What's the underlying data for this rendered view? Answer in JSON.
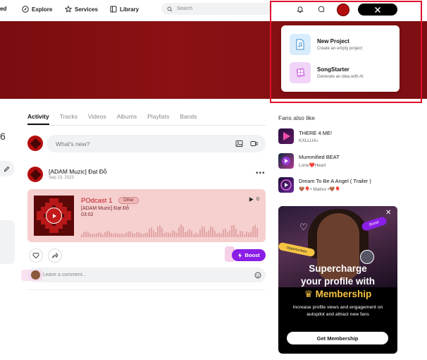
{
  "nav": {
    "edge_text": "ed",
    "explore": "Explore",
    "services": "Services",
    "library": "Library",
    "search_placeholder": "Search"
  },
  "dropdown": {
    "items": [
      {
        "title": "New Project",
        "subtitle": "Create an empty project",
        "icon": "music-file-icon"
      },
      {
        "title": "SongStarter",
        "subtitle": "Generate an idea with AI",
        "icon": "songstarter-icon"
      }
    ]
  },
  "edge": {
    "digit": "6"
  },
  "tabs": [
    "Activity",
    "Tracks",
    "Videos",
    "Albums",
    "Playlists",
    "Bands"
  ],
  "composer": {
    "placeholder": "What's new?"
  },
  "post": {
    "title": "[ADAM Muzic] Đạt Đỗ",
    "date": "Sep 13, 2023",
    "audio": {
      "title": "POdcast 1",
      "tag": "Other",
      "artist": "[ADAM Muzic] Đạt Đỗ",
      "duration": "03:02",
      "plays": "0"
    },
    "boost_label": "Boost",
    "comment_placeholder": "Leave a comment..."
  },
  "fans": {
    "title": "Fans also like",
    "items": [
      {
        "name": "THERE 4 ME!",
        "sub": "KXLLUA♪"
      },
      {
        "name": "Mummified BEAT",
        "sub": "Lone❤️Heart"
      },
      {
        "name": "Dream To Be A Angel ( Trailer )",
        "sub": "🤎🎈• Matixx •🤎🎈"
      }
    ]
  },
  "promo": {
    "badge_boost": "Boost",
    "badge_opportunities": "Opportunities",
    "headline_1": "Supercharge",
    "headline_2": "your profile with",
    "headline_3": "Membership",
    "body": "Increase profile views and engagement on autopilot and attract new fans",
    "cta": "Get Membership"
  },
  "colors": {
    "accent": "#8a1ee6",
    "banner": "#7a0c0f",
    "highlight": "#e0102a",
    "membership": "#f6c443"
  }
}
